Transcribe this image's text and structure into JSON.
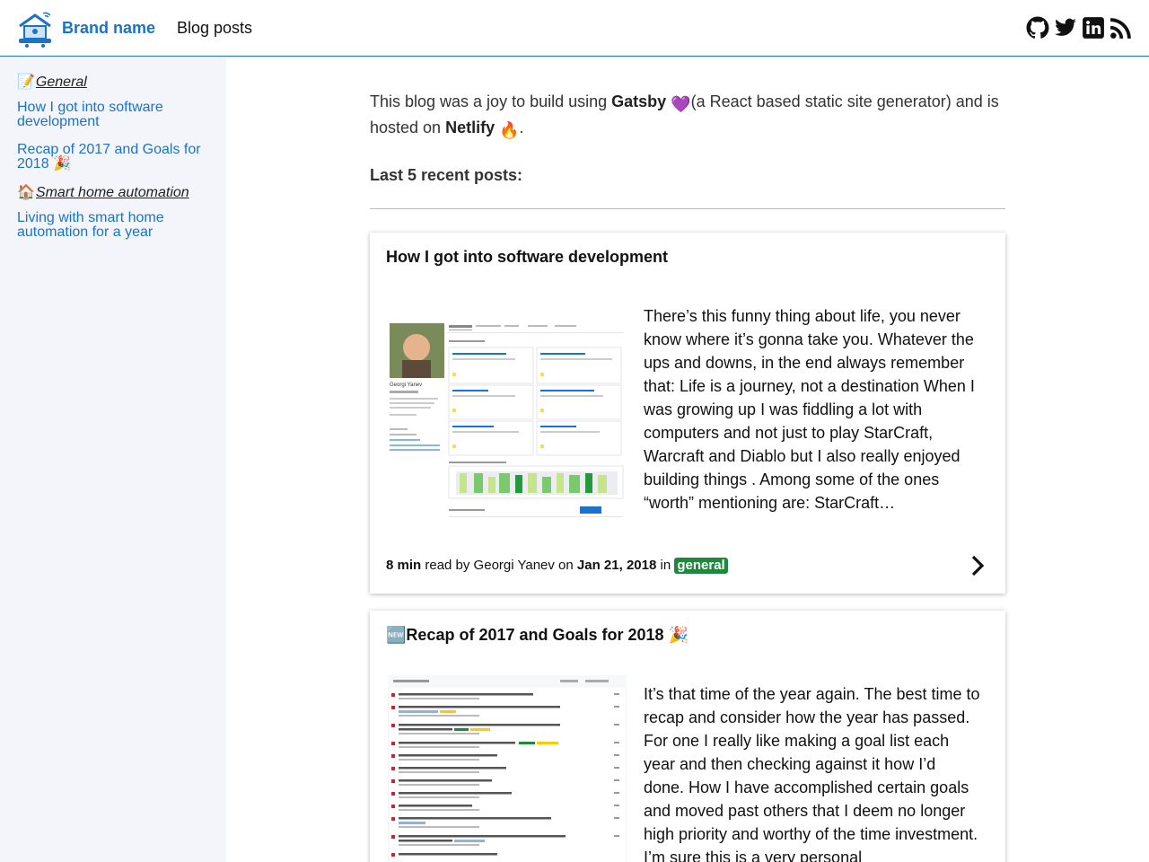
{
  "header": {
    "brand": "Brand name",
    "nav_blog": "Blog posts",
    "social_icons": [
      "github-icon",
      "twitter-icon",
      "linkedin-icon",
      "rss-icon"
    ]
  },
  "sidebar": {
    "categories": [
      {
        "emoji": "📝",
        "label": "General",
        "posts": [
          "How I got into software development",
          "Recap of 2017 and Goals for 2018 🎉"
        ]
      },
      {
        "emoji": "🏠",
        "label": "Smart home automation",
        "posts": [
          "Living with smart home automation for a year"
        ]
      }
    ]
  },
  "intro": {
    "p1": "This blog was a joy to build using ",
    "gatsby": "Gatsby",
    "heart": "💜",
    "p2": "(a React based static site generator) and is hosted on ",
    "netlify": "Netlify",
    "fire": "🔥",
    "p3": "."
  },
  "recent_title": "Last 5 recent posts:",
  "posts": [
    {
      "title": "How I got into software development",
      "excerpt": "There’s this funny thing about life, you never know where it’s gonna take you. Whatever the ups and downs, in the end always remember that: Life is a journey, not a destination When I was growing up I was fiddling a lot with computers and not just to play StarCraft, Warcraft and Diablo but I also really enjoyed building things . Among some of the ones “worth” mentioning are: StarCraft…",
      "read_time": "8 min",
      "read_by": " read by Georgi Yanev on ",
      "date": "Jan 21, 2018",
      "in": " in ",
      "tag": "general",
      "thumb_name": "Georgi Yanev"
    },
    {
      "badge": "🆕",
      "title": "Recap of 2017 and Goals for 2018 🎉",
      "excerpt": "It’s that time of the year again. The best time to recap and consider how the year has passed. For one I really like making a goal list each year and then checking against it how I’d done. How I have accomplished certain goals and moved past others that I deem no longer high priority and worthy of the time investment. I’m sure this is a very personal"
    }
  ],
  "colors": {
    "link": "#1a73c8",
    "tag_bg": "#1d8a3b",
    "sidebar_bg": "#f4f5fb"
  }
}
